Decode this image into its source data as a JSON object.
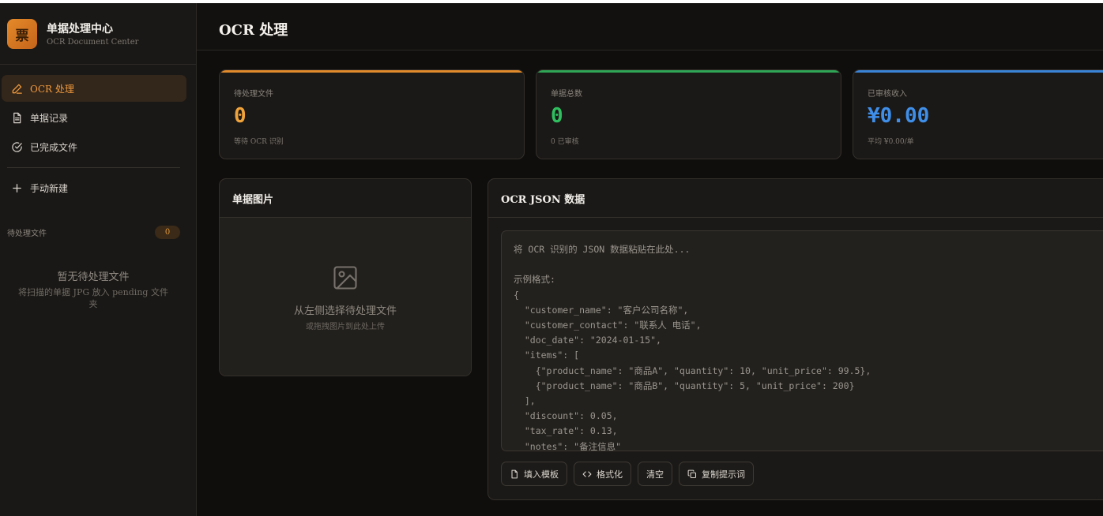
{
  "app": {
    "logo_char": "票",
    "title": "单据处理中心",
    "subtitle": "OCR Document Center"
  },
  "sidebar": {
    "items": [
      {
        "label": "OCR 处理",
        "icon": "pencil-icon",
        "active": true
      },
      {
        "label": "单据记录",
        "icon": "document-icon",
        "active": false
      },
      {
        "label": "已完成文件",
        "icon": "check-circle-icon",
        "active": false
      },
      {
        "label": "手动新建",
        "icon": "plus-icon",
        "active": false
      }
    ],
    "pending_label": "待处理文件",
    "pending_count": "0",
    "empty_title": "暂无待处理文件",
    "empty_sub": "将扫描的单据 JPG 放入 pending 文件夹"
  },
  "header": {
    "title": "OCR 处理"
  },
  "stats": [
    {
      "label": "待处理文件",
      "value": "0",
      "sub": "等待 OCR 识别",
      "color": "#f0a33a"
    },
    {
      "label": "单据总数",
      "value": "0",
      "sub": "0 已审核",
      "color": "#2fbf5f"
    },
    {
      "label": "已审核收入",
      "value": "¥0.00",
      "sub": "平均 ¥0.00/单",
      "color": "#3f8ee8"
    }
  ],
  "image_panel": {
    "title": "单据图片",
    "icon": "image-icon",
    "hint": "从左侧选择待处理文件",
    "sub_hint": "或拖拽图片到此处上传"
  },
  "json_panel": {
    "title": "OCR JSON 数据",
    "placeholder": "将 OCR 识别的 JSON 数据粘贴在此处...\n\n示例格式:\n{\n  \"customer_name\": \"客户公司名称\",\n  \"customer_contact\": \"联系人 电话\",\n  \"doc_date\": \"2024-01-15\",\n  \"items\": [\n    {\"product_name\": \"商品A\", \"quantity\": 10, \"unit_price\": 99.5},\n    {\"product_name\": \"商品B\", \"quantity\": 5, \"unit_price\": 200}\n  ],\n  \"discount\": 0.05,\n  \"tax_rate\": 0.13,\n  \"notes\": \"备注信息\"",
    "buttons": [
      {
        "label": "填入模板",
        "icon": "file-icon"
      },
      {
        "label": "格式化",
        "icon": "code-icon"
      },
      {
        "label": "清空",
        "icon": ""
      },
      {
        "label": "复制提示词",
        "icon": "copy-icon"
      }
    ]
  }
}
